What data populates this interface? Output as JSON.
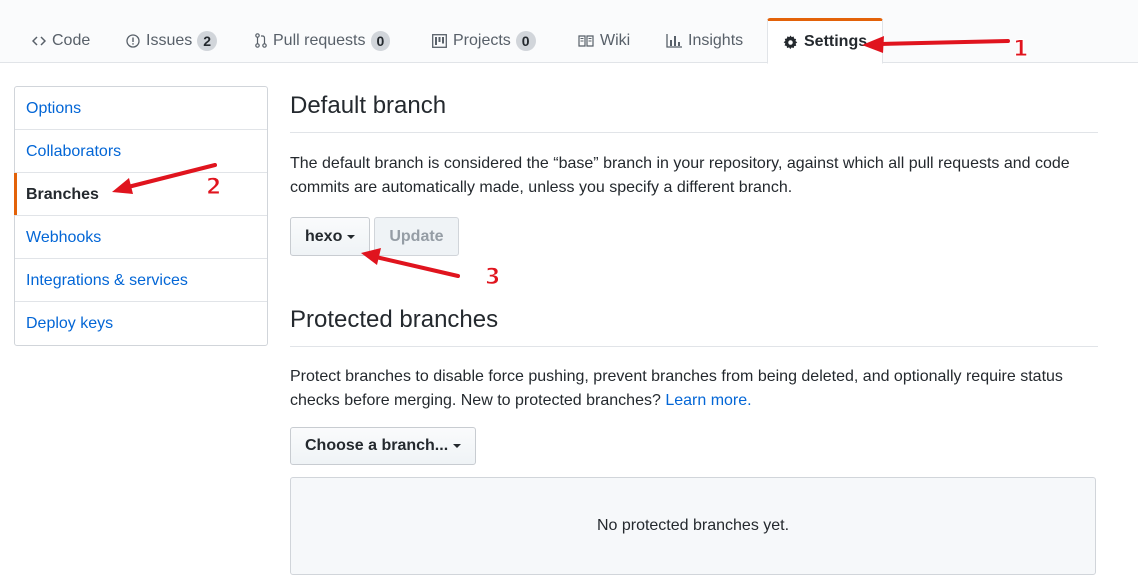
{
  "tabs": [
    {
      "label": "Code",
      "icon": "code-icon",
      "count": ""
    },
    {
      "label": "Issues",
      "icon": "issue-icon",
      "count": "2"
    },
    {
      "label": "Pull requests",
      "icon": "pull-request-icon",
      "count": "0"
    },
    {
      "label": "Projects",
      "icon": "project-icon",
      "count": "0"
    },
    {
      "label": "Wiki",
      "icon": "book-icon",
      "count": ""
    },
    {
      "label": "Insights",
      "icon": "graph-icon",
      "count": ""
    },
    {
      "label": "Settings",
      "icon": "gear-icon",
      "count": "",
      "selected": true
    }
  ],
  "sidebar": {
    "items": [
      {
        "label": "Options"
      },
      {
        "label": "Collaborators"
      },
      {
        "label": "Branches",
        "selected": true
      },
      {
        "label": "Webhooks"
      },
      {
        "label": "Integrations & services"
      },
      {
        "label": "Deploy keys"
      }
    ]
  },
  "default_branch": {
    "heading": "Default branch",
    "description": "The default branch is considered the “base” branch in your repository, against which all pull requests and code commits are automatically made, unless you specify a different branch.",
    "branch_button": "hexo",
    "update_button": "Update"
  },
  "protected_branches": {
    "heading": "Protected branches",
    "description": "Protect branches to disable force pushing, prevent branches from being deleted, and optionally require status checks before merging. New to protected branches?",
    "learn_more": "Learn more.",
    "choose_button": "Choose a branch...",
    "empty_text": "No protected branches yet."
  },
  "annotations": {
    "numbers": [
      "1",
      "2",
      "3"
    ],
    "arrow_color": "#e0141e"
  },
  "colors": {
    "accent_orange": "#e36209",
    "link_blue": "#0366d6"
  }
}
